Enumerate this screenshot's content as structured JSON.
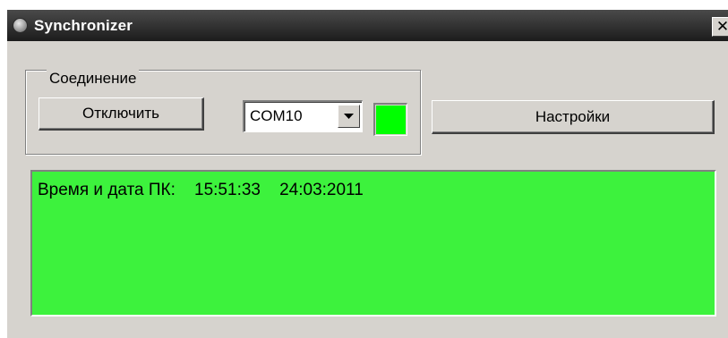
{
  "window": {
    "title": "Synchronizer",
    "close_glyph": "✕",
    "title_icon": "app-globe-icon"
  },
  "connection": {
    "group_label": "Соединение",
    "disconnect_label": "Отключить",
    "port_selected": "COM10",
    "status_color": "#00ff00"
  },
  "settings": {
    "label": "Настройки"
  },
  "log": {
    "background_color": "#3df23d",
    "line": "Время и дата ПК:    15:51:33    24:03:2011"
  }
}
